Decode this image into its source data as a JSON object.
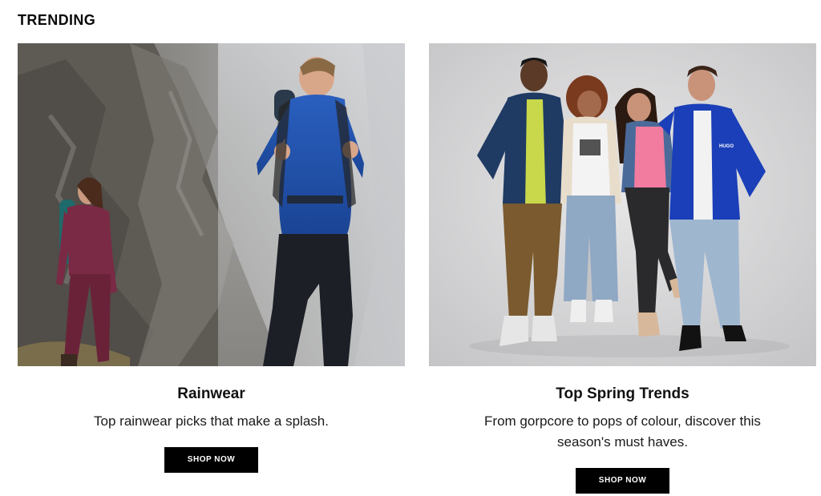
{
  "section": {
    "title": "TRENDING"
  },
  "cards": [
    {
      "title": "Rainwear",
      "description": "Top rainwear picks that make a splash.",
      "button_label": "SHOP NOW"
    },
    {
      "title": "Top Spring Trends",
      "description": "From gorpcore to pops of colour, discover this season's must haves.",
      "button_label": "SHOP NOW"
    }
  ],
  "colors": {
    "button_bg": "#000000",
    "button_text": "#ffffff",
    "rain_jacket": "#1f4fa8",
    "hiker_suit": "#7a2a45",
    "studio_bg": "#d4d4d6"
  }
}
